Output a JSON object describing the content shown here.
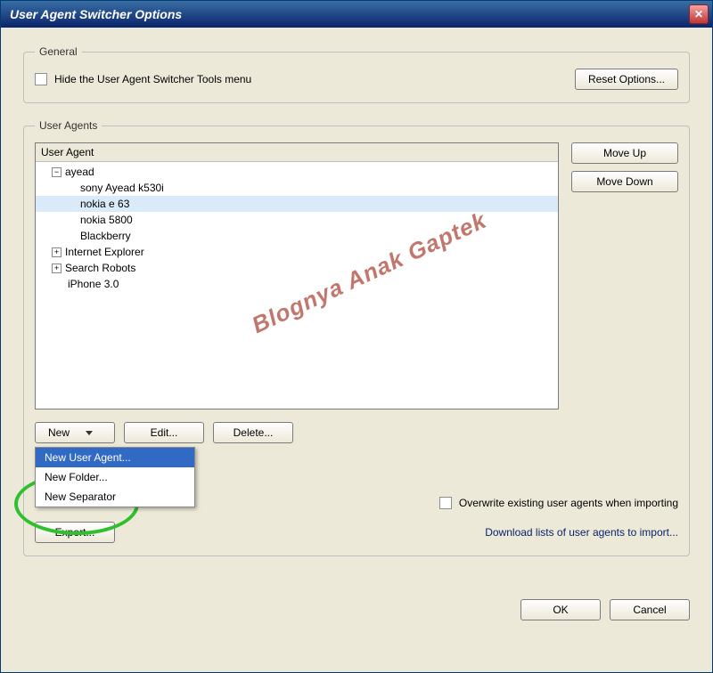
{
  "window": {
    "title": "User Agent Switcher Options"
  },
  "general": {
    "legend": "General",
    "hide_checkbox_label": "Hide the User Agent Switcher Tools menu",
    "reset_button": "Reset Options..."
  },
  "user_agents": {
    "legend": "User Agents",
    "column_header": "User Agent",
    "tree": [
      {
        "label": "ayead",
        "type": "parent",
        "expanded": true
      },
      {
        "label": "sony Ayead k530i",
        "type": "child"
      },
      {
        "label": "nokia e 63",
        "type": "child",
        "highlighted": true
      },
      {
        "label": "nokia 5800",
        "type": "child"
      },
      {
        "label": "Blackberry",
        "type": "child"
      },
      {
        "label": "Internet Explorer",
        "type": "parent",
        "expanded": false
      },
      {
        "label": "Search Robots",
        "type": "parent",
        "expanded": false
      },
      {
        "label": "iPhone 3.0",
        "type": "leaf"
      }
    ],
    "move_up": "Move Up",
    "move_down": "Move Down",
    "new_button": "New",
    "edit_button": "Edit...",
    "delete_button": "Delete...",
    "dropdown": {
      "new_user_agent": "New User Agent...",
      "new_folder": "New Folder...",
      "new_separator": "New Separator"
    },
    "overwrite_label": "Overwrite existing user agents when importing",
    "export_button": "Export...",
    "download_link": "Download lists of user agents to import..."
  },
  "dialog": {
    "ok": "OK",
    "cancel": "Cancel"
  },
  "watermark": "Blognya Anak Gaptek"
}
